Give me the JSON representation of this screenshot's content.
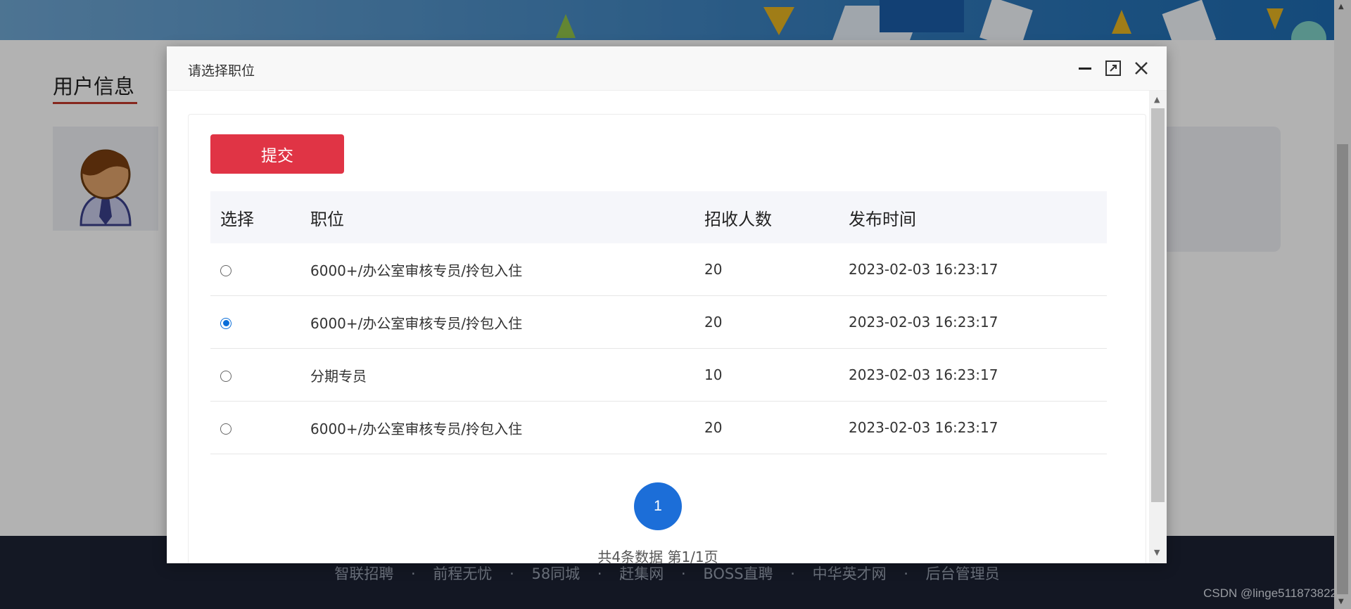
{
  "page": {
    "section_title": "用户信息",
    "footer_links": [
      "智联招聘",
      "前程无忧",
      "58同城",
      "赶集网",
      "BOSS直聘",
      "中华英才网",
      "后台管理员"
    ],
    "footer_separator": "·",
    "watermark": "CSDN @linge511873822"
  },
  "modal": {
    "title": "请选择职位",
    "controls": {
      "minimize_icon": "minimize-icon",
      "maximize_icon": "maximize-icon",
      "close_icon": "close-icon"
    },
    "submit_label": "提交",
    "columns": [
      "选择",
      "职位",
      "招收人数",
      "发布时间"
    ],
    "rows": [
      {
        "selected": false,
        "position": "6000+/办公室审核专员/拎包入住",
        "count": "20",
        "time": "2023-02-03 16:23:17"
      },
      {
        "selected": true,
        "position": "6000+/办公室审核专员/拎包入住",
        "count": "20",
        "time": "2023-02-03 16:23:17"
      },
      {
        "selected": false,
        "position": "分期专员",
        "count": "10",
        "time": "2023-02-03 16:23:17"
      },
      {
        "selected": false,
        "position": "6000+/办公室审核专员/拎包入住",
        "count": "20",
        "time": "2023-02-03 16:23:17"
      }
    ],
    "pagination": {
      "current_page": "1",
      "info": "共4条数据  第1/1页"
    }
  },
  "colors": {
    "submit": "#e03445",
    "accent": "#1c6ed8",
    "footer": "#1c2233"
  }
}
